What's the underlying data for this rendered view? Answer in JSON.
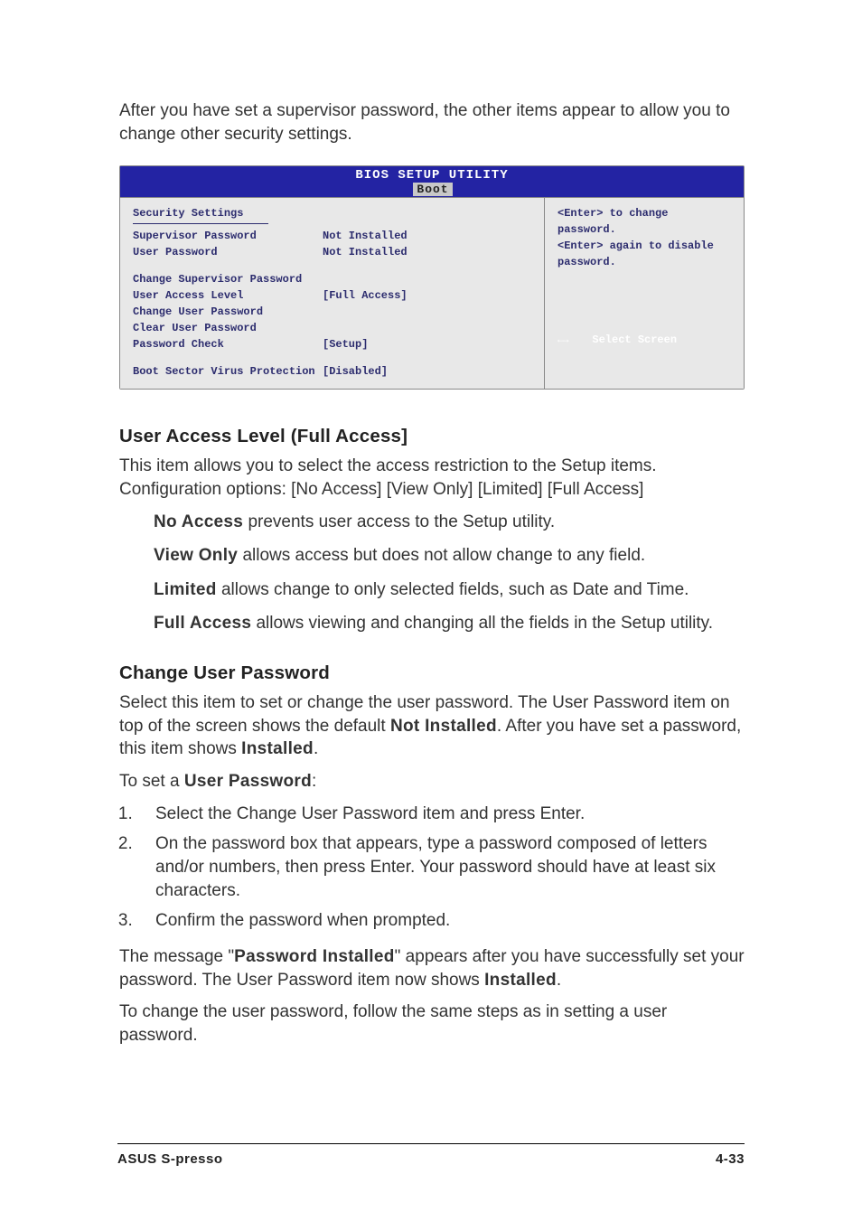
{
  "intro": "After you have set a supervisor password, the other items appear to allow you to change other security settings.",
  "bios": {
    "header_title": "BIOS SETUP UTILITY",
    "tab": "Boot",
    "section_title": "Security Settings",
    "rows": {
      "supervisor_label": "Supervisor Password",
      "supervisor_value": "Not Installed",
      "user_label": "User Password",
      "user_value": "Not Installed",
      "change_supervisor": "Change Supervisor Password",
      "user_access_label": "User Access Level",
      "user_access_value": "[Full Access]",
      "change_user": "Change User Password",
      "clear_user": "Clear User Password",
      "pw_check_label": "Password Check",
      "pw_check_value": "[Setup]",
      "boot_virus_label": "Boot Sector Virus Protection",
      "boot_virus_value": "[Disabled]"
    },
    "help1": "<Enter> to change password.",
    "help2": "<Enter> again to disable password.",
    "nav_arrow": "←→",
    "nav_text": "Select Screen"
  },
  "section1": {
    "title": "User Access Level (Full Access]",
    "p1": "This item allows you to select the access restriction to the Setup items. Configuration options: [No Access] [View Only] [Limited] [Full Access]",
    "no_access_b": "No Access",
    "no_access_t": " prevents user access to the Setup utility.",
    "view_only_b": "View Only",
    "view_only_t": " allows access but does not allow change to any field.",
    "limited_b": "Limited",
    "limited_t": " allows change to only selected fields, such as Date and Time.",
    "full_access_b": "Full Access",
    "full_access_t": " allows viewing and changing all the fields in the Setup utility."
  },
  "section2": {
    "title": "Change User Password",
    "p1a": "Select this item to set or change the user password. The User Password item on top of the screen shows the default ",
    "p1b": "Not Installed",
    "p1c": ". After you have set a password, this item shows ",
    "p1d": "Installed",
    "p1e": ".",
    "toset_a": "To set a ",
    "toset_b": "User Password",
    "toset_c": ":",
    "step1": "Select the Change User Password item and press Enter.",
    "step2": "On the password box that appears, type a password composed of letters and/or numbers, then press Enter. Your password should have at least six characters.",
    "step3": "Confirm the password when prompted.",
    "msg_a": "The message \"",
    "msg_b": "Password Installed",
    "msg_c": "\" appears after you have successfully set your password. The User Password item now shows ",
    "msg_d": "Installed",
    "msg_e": ".",
    "p2": "To change the user password, follow the same steps as in setting a user password."
  },
  "footer": {
    "left": "ASUS S-presso",
    "right": "4-33"
  }
}
